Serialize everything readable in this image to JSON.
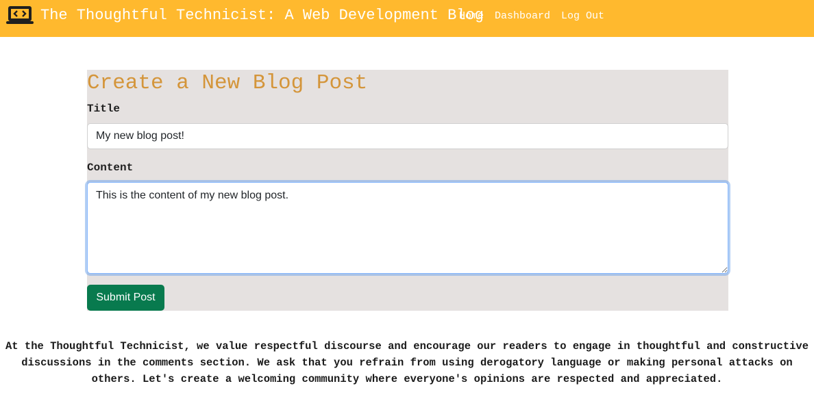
{
  "navbar": {
    "logo_icon": "laptop-code-icon",
    "brand": "The Thoughtful Technicist: A Web Development Blog",
    "links": [
      "Home",
      "Dashboard",
      "Log Out"
    ],
    "background_color": "#ffb92e"
  },
  "form": {
    "heading": "Create a New Blog Post",
    "title_label": "Title",
    "title_value": "My new blog post!",
    "content_label": "Content",
    "content_value": "This is the content of my new blog post.",
    "submit_label": "Submit Post",
    "heading_color": "#d4953a",
    "panel_color": "#e5e1e0",
    "submit_color": "#087a4e"
  },
  "footer": {
    "note": "At the Thoughtful Technicist, we value respectful discourse and encourage our readers to engage in thoughtful and constructive discussions in the comments section. We ask that you refrain from using derogatory language or making personal attacks on others. Let's create a welcoming community where everyone's opinions are respected and appreciated."
  }
}
